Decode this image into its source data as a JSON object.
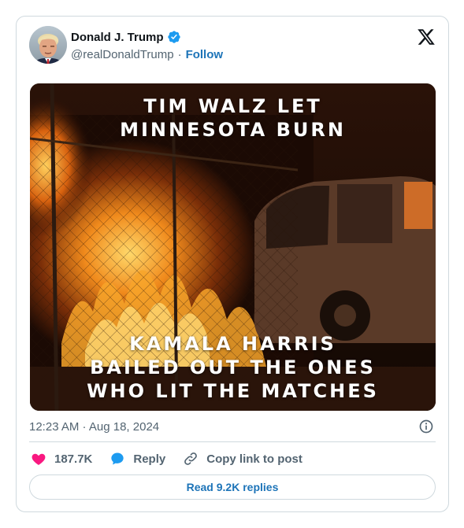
{
  "post": {
    "author": {
      "display_name": "Donald J. Trump",
      "handle": "@realDonaldTrump",
      "verified": true,
      "follow_label": "Follow"
    },
    "media": {
      "headline_top": [
        "TIM WALZ LET",
        "MINNESOTA BURN"
      ],
      "headline_bottom": [
        "KAMALA HARRIS",
        "BAILED OUT THE ONES",
        "WHO LIT THE MATCHES"
      ]
    },
    "timestamp": "12:23 AM · Aug 18, 2024",
    "actions": {
      "likes_count": "187.7K",
      "reply_label": "Reply",
      "copy_link_label": "Copy link to post"
    },
    "read_replies_label": "Read 9.2K replies"
  },
  "colors": {
    "link_blue": "#1d74b8",
    "heart_pink": "#f91880",
    "reply_blue": "#1d9bf0",
    "verified_blue": "#1d9bf0",
    "secondary_text": "#536471",
    "border": "#cfd9de"
  },
  "icons": {
    "brand": "x-logo-icon",
    "verified": "verified-badge-icon",
    "info": "info-icon",
    "like": "heart-icon",
    "reply": "chat-bubble-icon",
    "copy_link": "link-icon"
  }
}
